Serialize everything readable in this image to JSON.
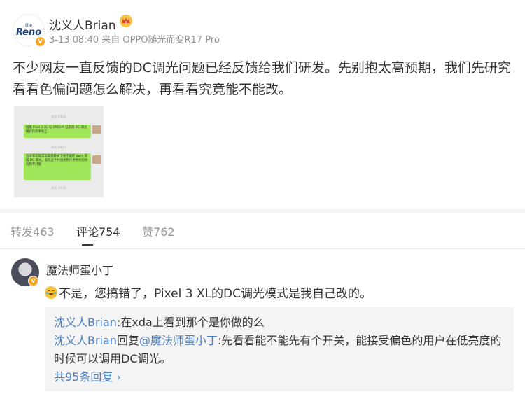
{
  "post": {
    "avatar_logo_small": "the",
    "avatar_logo": "Reno",
    "username": "沈义人Brian",
    "meta": "3-13 08:40 来自 OPPO随光而变R17 Pro",
    "text": "不少网友一直反馈的DC调光问题已经反馈给我们研发。先别抱太高预期，我们先研究看看色偏问题怎么解决，再看看究竟能不能改。"
  },
  "chat_image": {
    "messages": [
      {
        "time": "昨天 09:04",
        "text": "据看 Pixel 3 XL 有 SMDHA 已实现 DC 调光模式在的手机上...",
        "side": "left"
      },
      {
        "time": "昨天 09:11",
        "text": "有没有可能实现高频模式下面不能把 pwm 改成 DC 调光，现在这个时间点用户用手机的体验和不舒服",
        "side": "left"
      },
      {
        "time": "昨天 10:40",
        "text": "",
        "side": "none"
      }
    ]
  },
  "tabs": [
    {
      "label": "转发",
      "count": "463",
      "active": false
    },
    {
      "label": "评论",
      "count": "754",
      "active": true
    },
    {
      "label": "赞",
      "count": "762",
      "active": false
    }
  ],
  "comment": {
    "username": "魔法师蛋小丁",
    "text": "不是，您搞错了，Pixel 3 XL的DC调光模式是我自己改的。",
    "emoji_name": "laughing-tears",
    "replies": [
      {
        "user": "沈义人Brian",
        "sep": ":",
        "text": "在xda上看到那个是你做的么"
      },
      {
        "user": "沈义人Brian",
        "reply_word": "回复",
        "mention": "@魔法师蛋小丁",
        "sep": ":",
        "text": "先看看能不能先有个开关，能接受偏色的用户在低亮度的时候可以调用DC调光。"
      }
    ],
    "more_replies": "共95条回复"
  },
  "colors": {
    "link": "#4b7fc1",
    "verified_badge": "#f6a623",
    "chat_bubble": "#9fe658",
    "muted": "#939393"
  }
}
